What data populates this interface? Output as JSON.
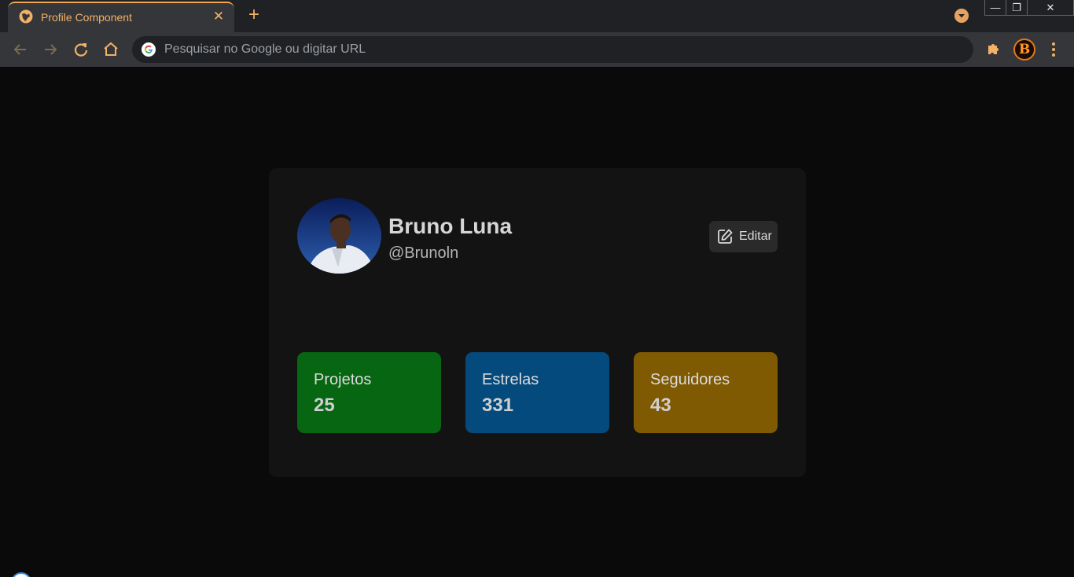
{
  "browser": {
    "tab": {
      "title": "Profile Component",
      "close_symbol": "✕"
    },
    "new_tab_symbol": "+",
    "window_controls": {
      "minimize": "—",
      "restore": "❐",
      "close": "✕"
    },
    "omnibox": {
      "placeholder": "Pesquisar no Google ou digitar URL"
    },
    "profile_initial": "B"
  },
  "profile": {
    "name": "Bruno Luna",
    "handle": "@Brunoln",
    "edit_label": "Editar"
  },
  "stats": [
    {
      "label": "Projetos",
      "value": "25",
      "color": "#066612"
    },
    {
      "label": "Estrelas",
      "value": "331",
      "color": "#054a7c"
    },
    {
      "label": "Seguidores",
      "value": "43",
      "color": "#7f5a02"
    }
  ],
  "colors": {
    "accent": "#f1a54c",
    "page_background": "#0a0a0a",
    "card_background": "#131313"
  }
}
